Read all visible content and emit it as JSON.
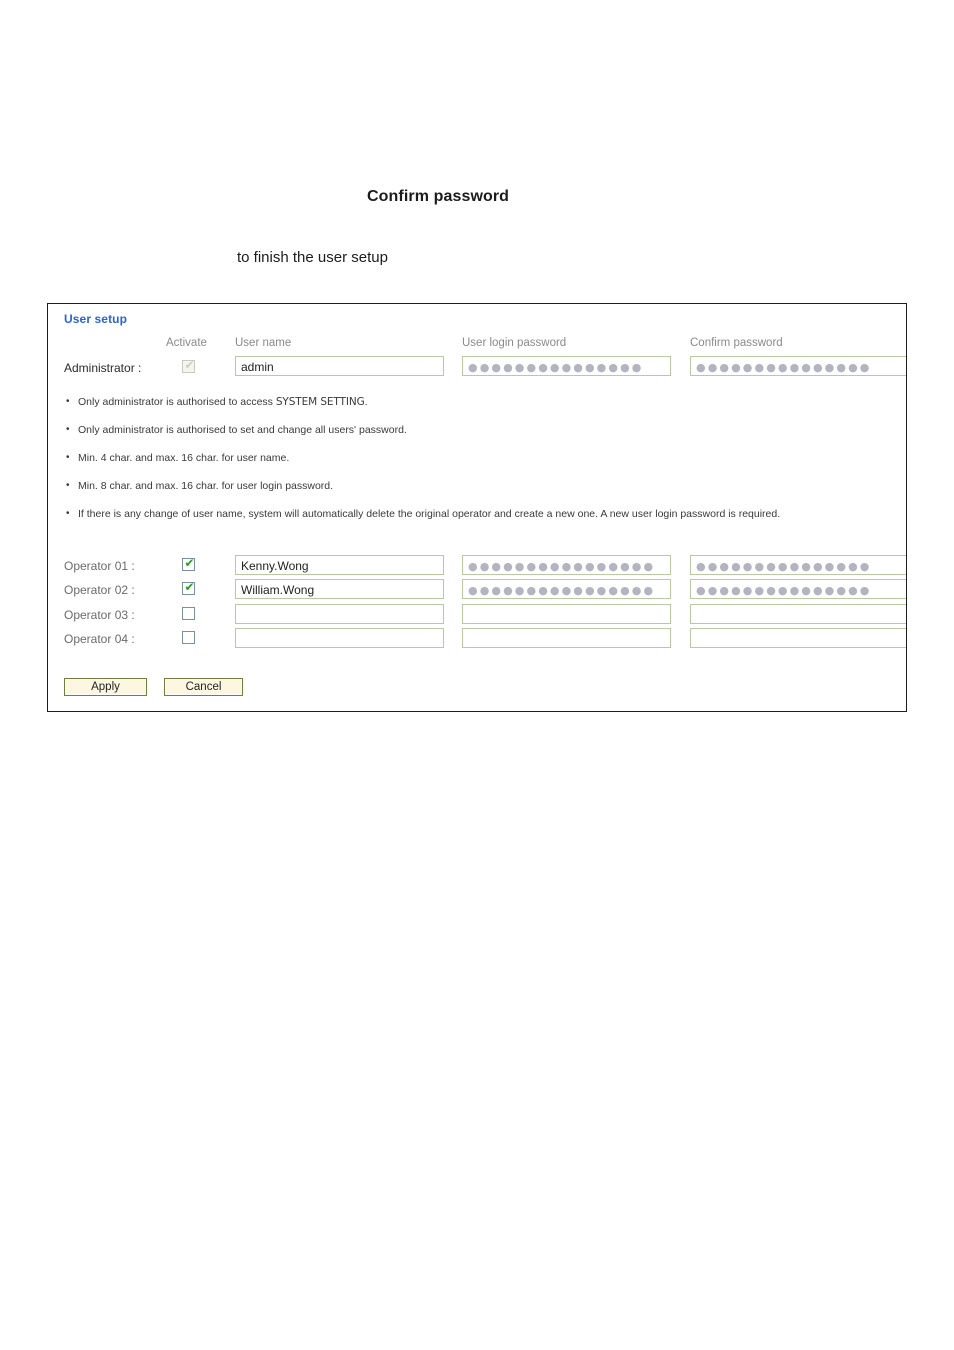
{
  "document": {
    "heading": "Confirm password",
    "subline": "to finish the user setup"
  },
  "panel": {
    "title": "User setup",
    "columns": {
      "activate": "Activate",
      "user_name": "User name",
      "user_login_password": "User login password",
      "confirm_password": "Confirm password"
    },
    "administrator": {
      "label": "Administrator :",
      "activate_checked": true,
      "activate_disabled": true,
      "user_name": "admin",
      "user_login_password": "●●●●●●●●●●●●●●●",
      "confirm_password": "●●●●●●●●●●●●●●●"
    },
    "notes": [
      {
        "text": "Only administrator is authorised to access ",
        "emphasis": "SYSTEM SETTING",
        "tail": "."
      },
      {
        "text": "Only administrator is authorised to set and change all users' password.",
        "emphasis": "",
        "tail": ""
      },
      {
        "text": "Min. 4 char. and max. 16 char. for user name.",
        "emphasis": "",
        "tail": ""
      },
      {
        "text": "Min. 8 char. and max. 16 char. for user login password.",
        "emphasis": "",
        "tail": ""
      },
      {
        "text": "If there is any change of user name, system will automatically delete the original operator and create a new one. A new user login password is required.",
        "emphasis": "",
        "tail": ""
      }
    ],
    "operators": [
      {
        "label": "Operator 01 :",
        "activate_checked": true,
        "user_name": "Kenny.Wong",
        "user_login_password": "●●●●●●●●●●●●●●●●",
        "confirm_password": "●●●●●●●●●●●●●●●"
      },
      {
        "label": "Operator 02 :",
        "activate_checked": true,
        "user_name": "William.Wong",
        "user_login_password": "●●●●●●●●●●●●●●●●",
        "confirm_password": "●●●●●●●●●●●●●●●"
      },
      {
        "label": "Operator 03 :",
        "activate_checked": false,
        "user_name": "",
        "user_login_password": "",
        "confirm_password": ""
      },
      {
        "label": "Operator 04 :",
        "activate_checked": false,
        "user_name": "",
        "user_login_password": "",
        "confirm_password": ""
      }
    ],
    "buttons": {
      "apply": "Apply",
      "cancel": "Cancel"
    },
    "colors": {
      "title_blue": "#2a63d6",
      "field_border_green": "#b9c9a4",
      "check_green": "#24a024",
      "button_face": "#fdf7e2",
      "button_border": "#6f7f3c",
      "panel_border": "#1d1d1d"
    }
  }
}
